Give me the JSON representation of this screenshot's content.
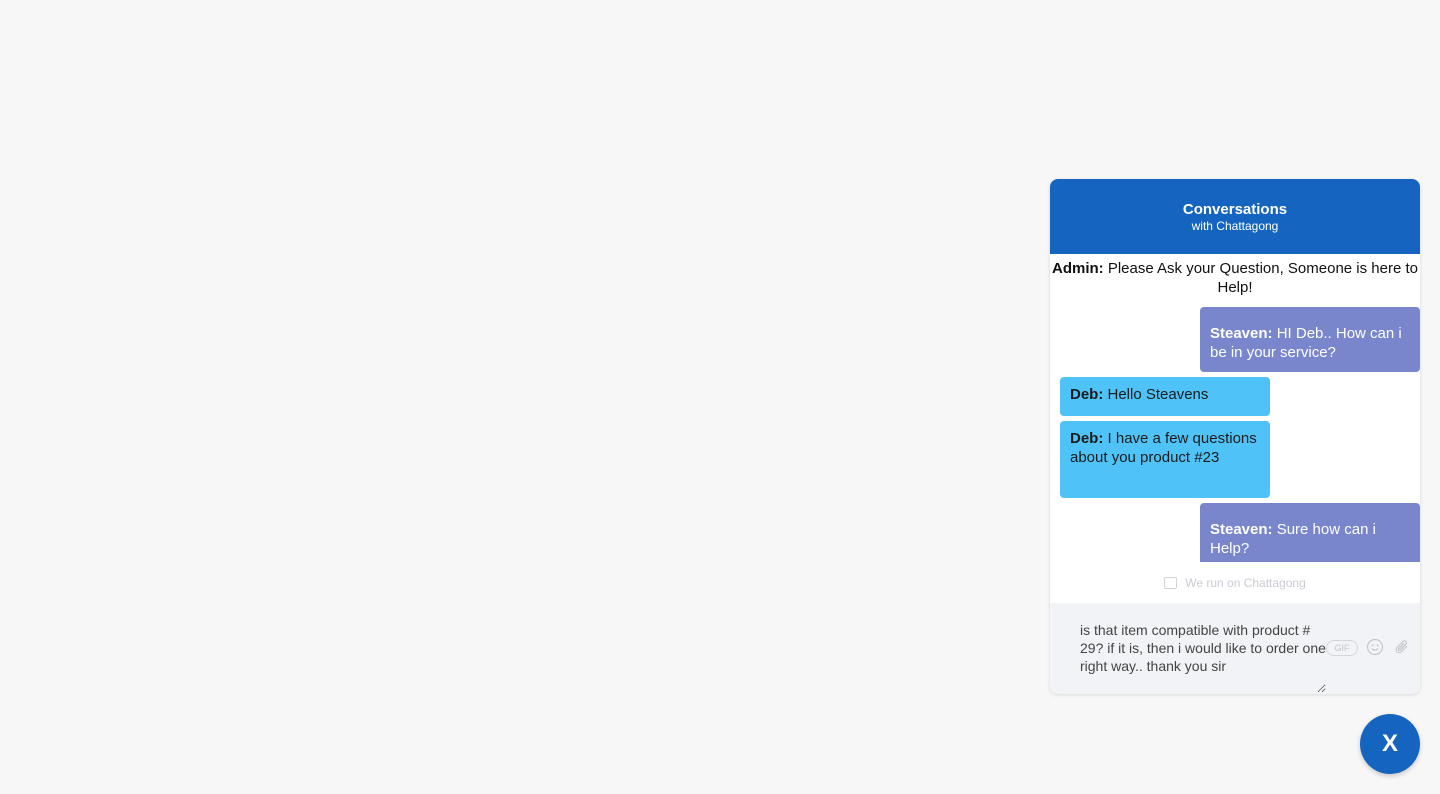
{
  "header": {
    "title": "Conversations",
    "subtitle": "with Chattagong"
  },
  "admin_message": {
    "sender": "Admin:",
    "text": " Please Ask your Question, Someone is here to Help!"
  },
  "messages": [
    {
      "sender": "Steaven:",
      "text": " HI Deb.. How can i be in your service?",
      "direction": "out"
    },
    {
      "sender": "Deb:",
      "text": " Hello Steavens",
      "direction": "in"
    },
    {
      "sender": "Deb:",
      "text": " I have a few questions about you product #23",
      "direction": "in"
    },
    {
      "sender": "Steaven:",
      "text": " Sure how can i Help?",
      "direction": "out"
    }
  ],
  "footer": {
    "powered_by": "We run on Chattagong"
  },
  "composer": {
    "value": "is that item compatible with product # 29? if it is, then i would like to order one right way.. thank you sir",
    "gif_label": "GIF"
  },
  "fab": {
    "label": "X"
  },
  "colors": {
    "brand": "#1565c0",
    "outgoing_bubble": "#7986cb",
    "incoming_bubble": "#4fc3f7"
  }
}
